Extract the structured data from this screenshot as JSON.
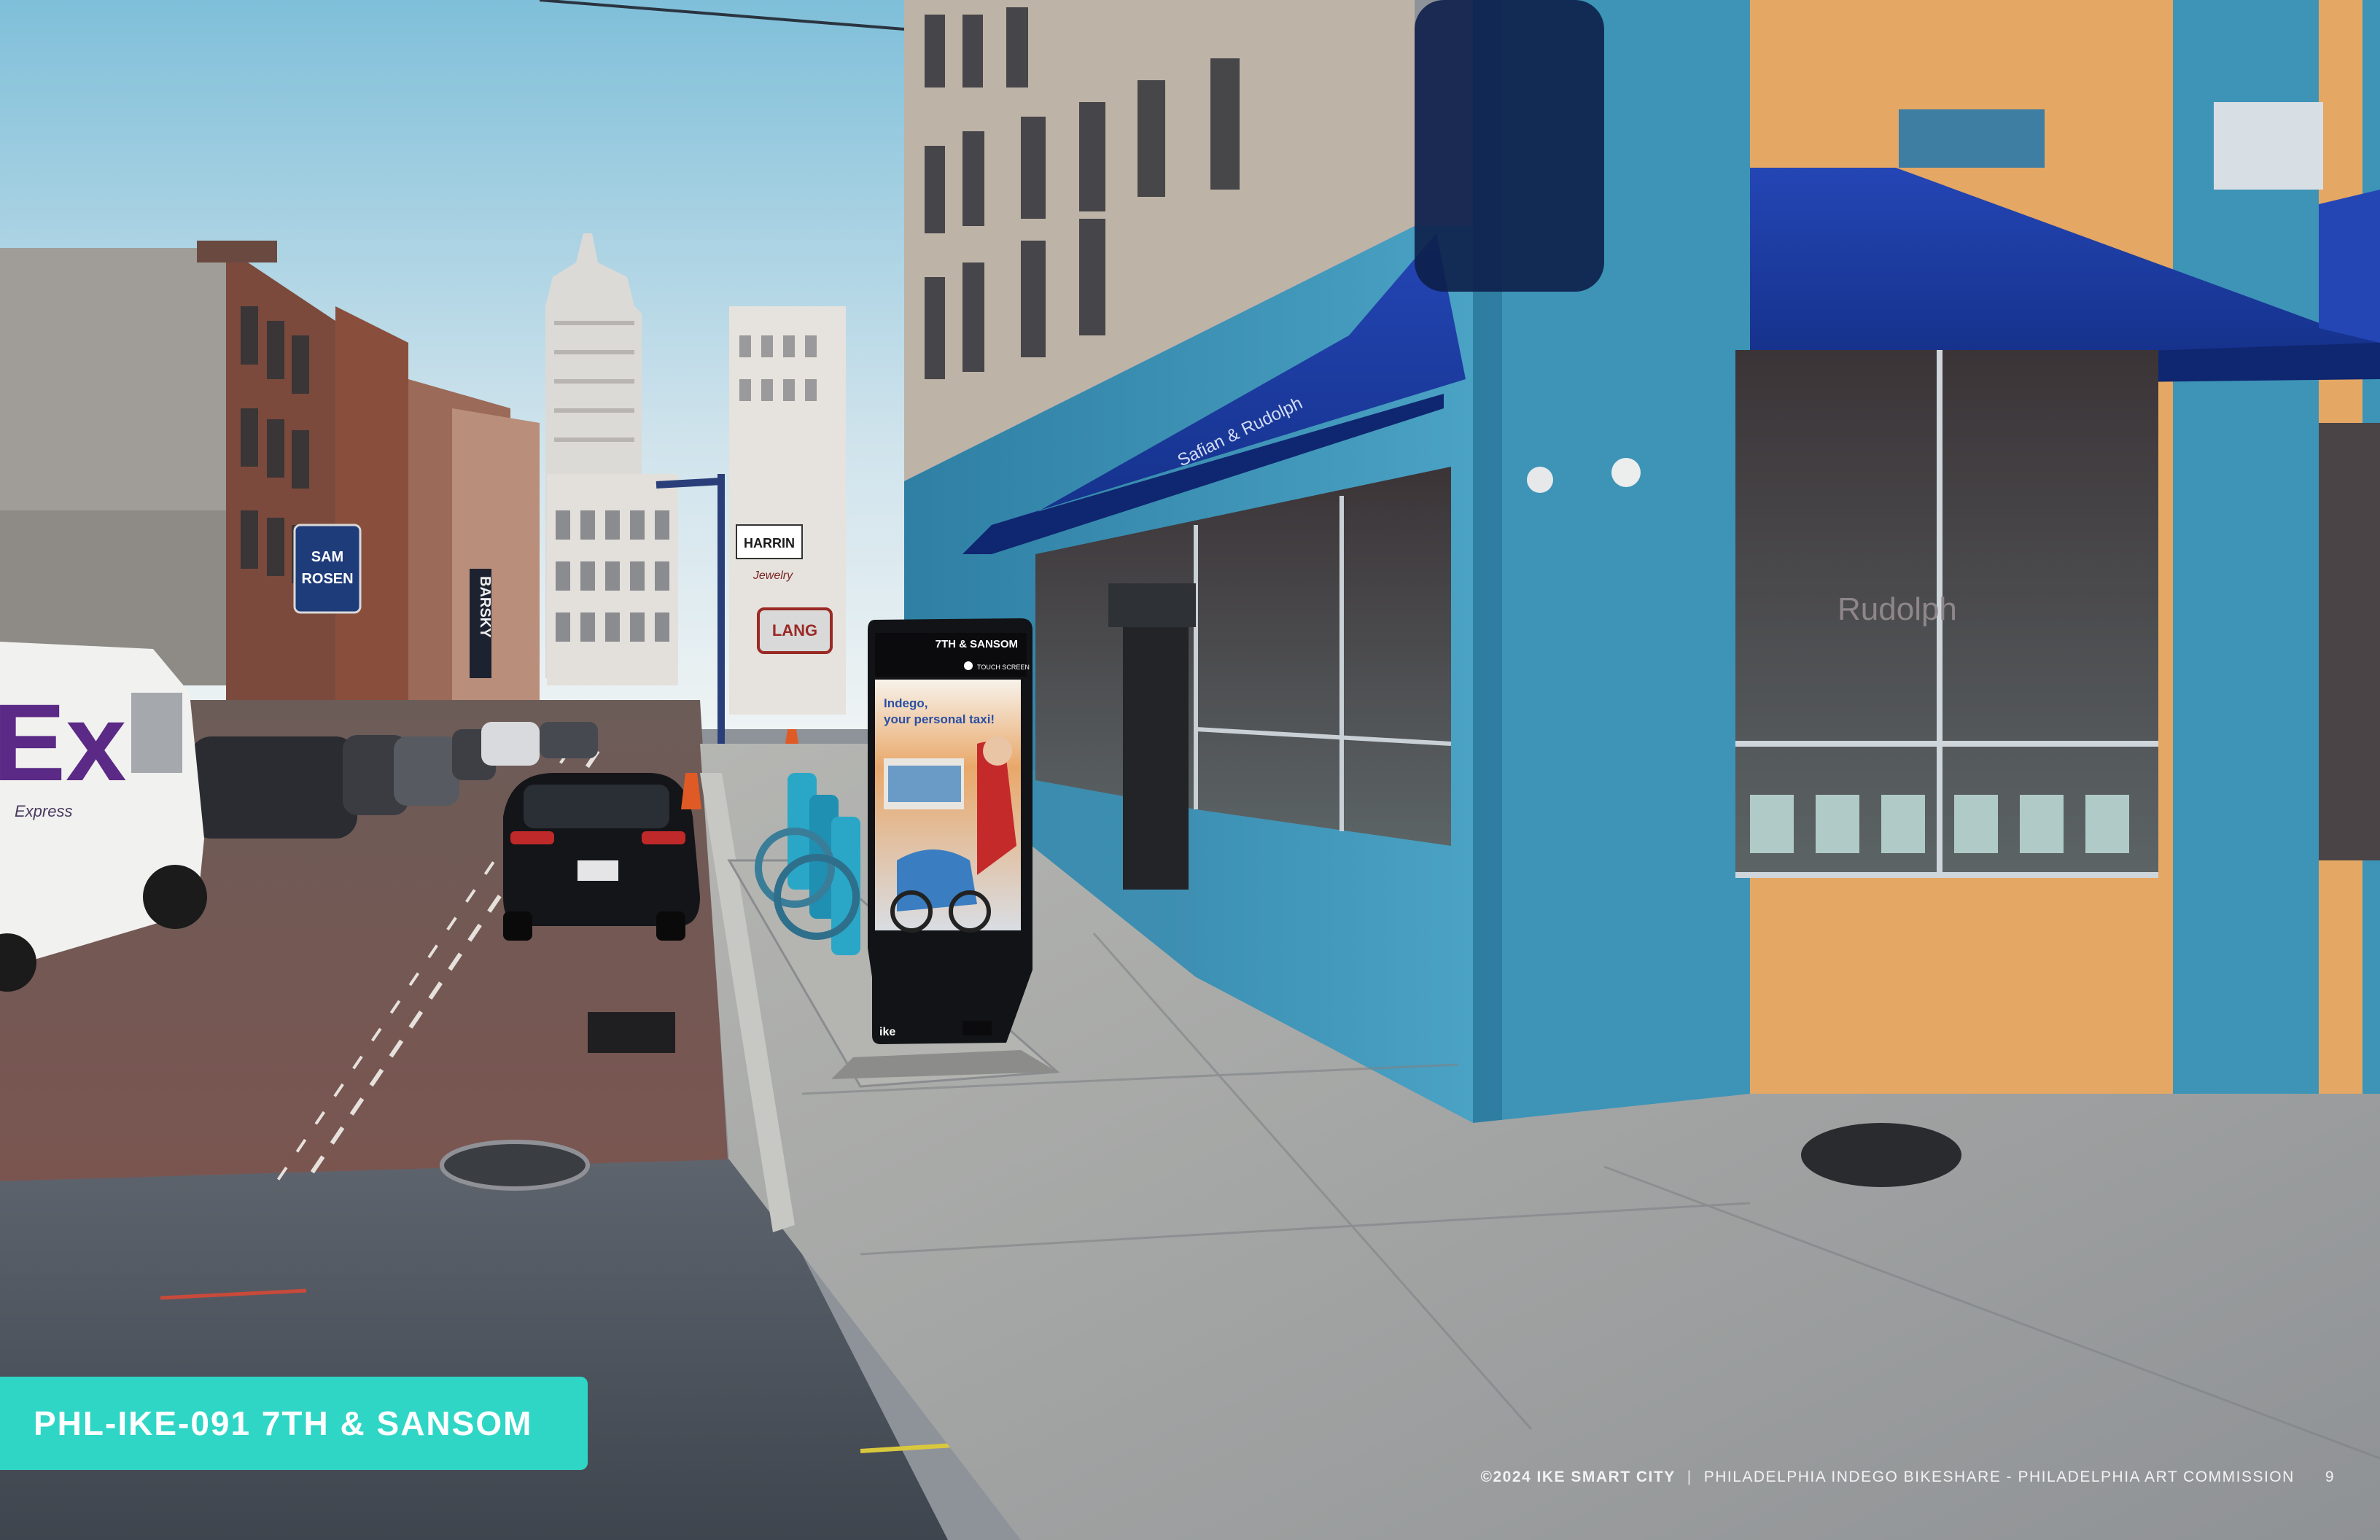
{
  "caption": {
    "text": "PHL-IKE-091 7TH & SANSOM"
  },
  "footer": {
    "copyright": "©2024 IKE SMART CITY",
    "separator": "|",
    "project": "PHILADELPHIA INDEGO BIKESHARE - PHILADELPHIA ART COMMISSION",
    "page": "9"
  },
  "kiosk": {
    "location": "7TH & SANSOM",
    "touch": "TOUCH SCREEN",
    "ad_headline_1": "Indego,",
    "ad_headline_2": "your personal taxi!",
    "brand": "ike"
  },
  "signage": {
    "truck_logo": "Ex",
    "truck_small": "Express",
    "awning_text": "Safian & Rudolph",
    "storefront_text": "Rudolph",
    "blade_sign": "BARSKY",
    "left_sign_1": "SAM",
    "left_sign_2": "ROSEN",
    "right_sign_1": "HARRIN",
    "right_sign_2": "Jewelry",
    "right_sign_3": "LANG"
  },
  "colors": {
    "accent": "#2fd6c6",
    "awning": "#1b3fa6",
    "tile": "#3f8fb0",
    "kiosk": "#121316"
  }
}
